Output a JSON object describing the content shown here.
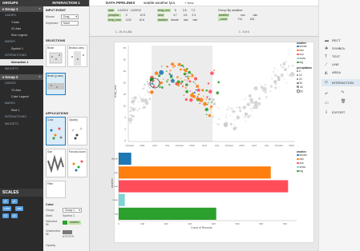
{
  "groups_panel": {
    "title": "GROUPS",
    "group1": {
      "label": "Group 1",
      "sub": [
        "GUIDES",
        "Y-Axis",
        "X2 Axis",
        "Size Legend",
        "MARKS",
        "Symbol 1",
        "INTERACTIONS",
        "Interaction 1",
        "WIDGETS"
      ]
    },
    "group2": {
      "label": "Group 2",
      "sub": [
        "GUIDES",
        "Y2 Axis",
        "Color Legend",
        "MARKS",
        "Rect 1",
        "INTERACTIONS",
        "WIDGETS"
      ]
    },
    "scales_title": "SCALES",
    "scales": [
      "x1",
      "y1",
      "color",
      "size",
      "x2",
      "y2"
    ]
  },
  "interaction_panel": {
    "title": "INTERACTION 1",
    "input_event": "INPUT EVENT",
    "mouse_label": "Mouse",
    "mouse_value": "Drag",
    "keyboard_label": "Keyboard",
    "keyboard_value": "None",
    "selections_title": "SELECTIONS",
    "selections": [
      "Brush",
      "Brush(x-axis)",
      "Brush (y-axis)"
    ],
    "applications_title": "APPLICATIONS",
    "applications": [
      "Color",
      "Opacity",
      "Size",
      "Pan and zoom",
      "Filter"
    ],
    "color_title": "Color",
    "group_label": "Group:",
    "group_value": "Group 1",
    "mark_label": "Mark:",
    "mark_value": "Symbol 1",
    "selected_label": "Selected fill",
    "selected_value": "weather",
    "unselected_label": "Unselected fill",
    "unselected_value": "#797979",
    "opacity_label": "Opacity"
  },
  "pipelines": {
    "title": "DATA PIPELINES",
    "active_tab": "seattle-weather.lyra",
    "new_label": "New",
    "table_rows": [
      [
        "date",
        "1/1/2012",
        "1/2/2012"
      ],
      [
        "precipita..",
        "0",
        "10.9"
      ],
      [
        "temp_max",
        "12.8",
        "10.6"
      ],
      [
        "temp_min",
        "5",
        "2.8"
      ],
      [
        "wind",
        "4.7",
        "4.5"
      ],
      [
        "weather",
        "drizzle",
        "rain"
      ]
    ],
    "col2": [
      [
        "temp_min",
        "5"
      ],
      [
        "wind",
        "4.7"
      ],
      [
        "weather",
        "drizzle"
      ]
    ],
    "col3": [
      [
        "2.8",
        "7.2"
      ],
      [
        "4.5",
        "2.3"
      ],
      [
        "rain",
        "rain"
      ]
    ],
    "groupby_title": "Group By weather",
    "groupby_rows": [
      [
        "weather",
        "sun",
        "rain"
      ],
      [
        "_count",
        "714",
        "641"
      ]
    ],
    "pager_left": "1 - 20 of 1,461",
    "pager_right": "1 - 5 of 5"
  },
  "toolbar": {
    "items": [
      "RECT",
      "SYMBOL",
      "TEXT",
      "LINE",
      "AREA",
      "INTERACTION",
      "",
      "",
      "EXPORT"
    ]
  },
  "scatter": {
    "ylabel": "temp_max",
    "xticks": [
      "October",
      "2011",
      "April",
      "July",
      "October",
      "2012",
      "April",
      "July",
      "October",
      "2013",
      "April",
      "July",
      "October",
      "2014"
    ],
    "yticks": [
      "35",
      "30",
      "25",
      "20",
      "15",
      "10",
      "5",
      "0",
      "-5"
    ]
  },
  "legend": {
    "weather_title": "weather",
    "items": [
      "drizzle",
      "rain",
      "sun",
      "snow",
      "fog"
    ],
    "colors": [
      "#1f77b4",
      "#ff7f0e",
      "#ff4d5a",
      "#7fd3d3",
      "#2ca02c"
    ],
    "precip_title": "precipitation",
    "precip_values": [
      "0",
      "10",
      "20",
      "30",
      "40",
      "50"
    ]
  },
  "chart_data": {
    "type": "bar",
    "categories": [
      "drizzle",
      "rain",
      "sun",
      "snow",
      "fog"
    ],
    "values": [
      53,
      641,
      714,
      26,
      411
    ],
    "colors": [
      "#1f77b4",
      "#ff7f0e",
      "#ff4d5a",
      "#7fd3d3",
      "#2ca02c"
    ],
    "xlabel": "Count of Records",
    "ylabel": "weather",
    "xticks": [
      "0",
      "100",
      "200",
      "300",
      "400",
      "500",
      "600",
      "700"
    ],
    "xlim": [
      0,
      750
    ]
  },
  "bar_legend": {
    "title": "weather",
    "items": [
      "drizzle",
      "rain",
      "sun",
      "snow",
      "fog"
    ]
  }
}
